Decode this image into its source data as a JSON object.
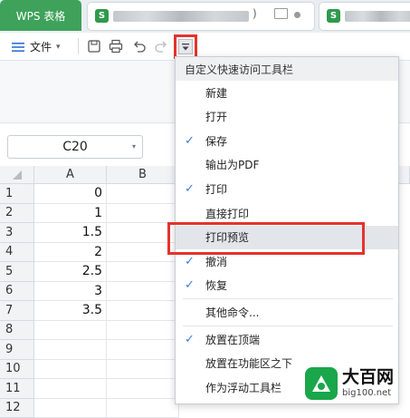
{
  "tabs": {
    "app_tab": "WPS 表格",
    "doc_badge": "S"
  },
  "toolbar": {
    "file_menu": "文件",
    "file_caret": "▾"
  },
  "namebox": {
    "value": "C20"
  },
  "grid": {
    "corner": "",
    "columns": [
      "A",
      "B"
    ],
    "rows": [
      {
        "n": "1",
        "a": "0"
      },
      {
        "n": "2",
        "a": "1"
      },
      {
        "n": "3",
        "a": "1.5"
      },
      {
        "n": "4",
        "a": "2"
      },
      {
        "n": "5",
        "a": "2.5"
      },
      {
        "n": "6",
        "a": "3"
      },
      {
        "n": "7",
        "a": "3.5"
      },
      {
        "n": "8",
        "a": ""
      },
      {
        "n": "9",
        "a": ""
      },
      {
        "n": "10",
        "a": ""
      },
      {
        "n": "11",
        "a": ""
      },
      {
        "n": "12",
        "a": ""
      }
    ]
  },
  "menu": {
    "title": "自定义快速访问工具栏",
    "items": [
      {
        "label": "新建",
        "checked": false
      },
      {
        "label": "打开",
        "checked": false
      },
      {
        "label": "保存",
        "checked": true
      },
      {
        "label": "输出为PDF",
        "checked": false
      },
      {
        "label": "打印",
        "checked": true
      },
      {
        "label": "直接打印",
        "checked": false
      },
      {
        "label": "打印预览",
        "checked": false
      },
      {
        "label": "撤消",
        "checked": true
      },
      {
        "label": "恢复",
        "checked": true
      }
    ],
    "more": "其他命令...",
    "position_items": [
      {
        "label": "放置在顶端",
        "checked": true
      },
      {
        "label": "放置在功能区之下",
        "checked": false
      },
      {
        "label": "作为浮动工具栏",
        "checked": false
      }
    ]
  },
  "watermark": {
    "name": "大百网",
    "url": "big100.net"
  },
  "colors": {
    "accent_green": "#3ea25a",
    "highlight_red": "#e5322d",
    "check_blue": "#3b7dd8"
  }
}
